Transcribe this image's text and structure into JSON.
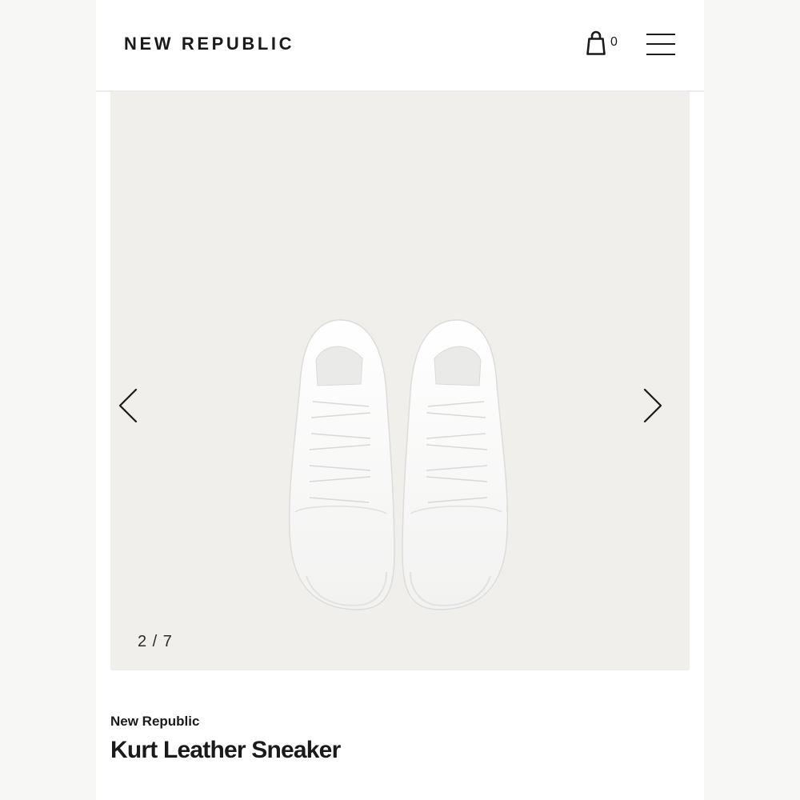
{
  "header": {
    "logo": "NEW REPUBLIC",
    "cart_icon": "shopping-bag-icon",
    "cart_count": "0",
    "menu_icon": "hamburger-menu-icon"
  },
  "gallery": {
    "prev_icon": "chevron-left-icon",
    "next_icon": "chevron-right-icon",
    "counter": "2 / 7",
    "image": "white-leather-sneakers-photo",
    "background_color": "#f0efec"
  },
  "product": {
    "brand": "New Republic",
    "name": "Kurt Leather Sneaker"
  }
}
